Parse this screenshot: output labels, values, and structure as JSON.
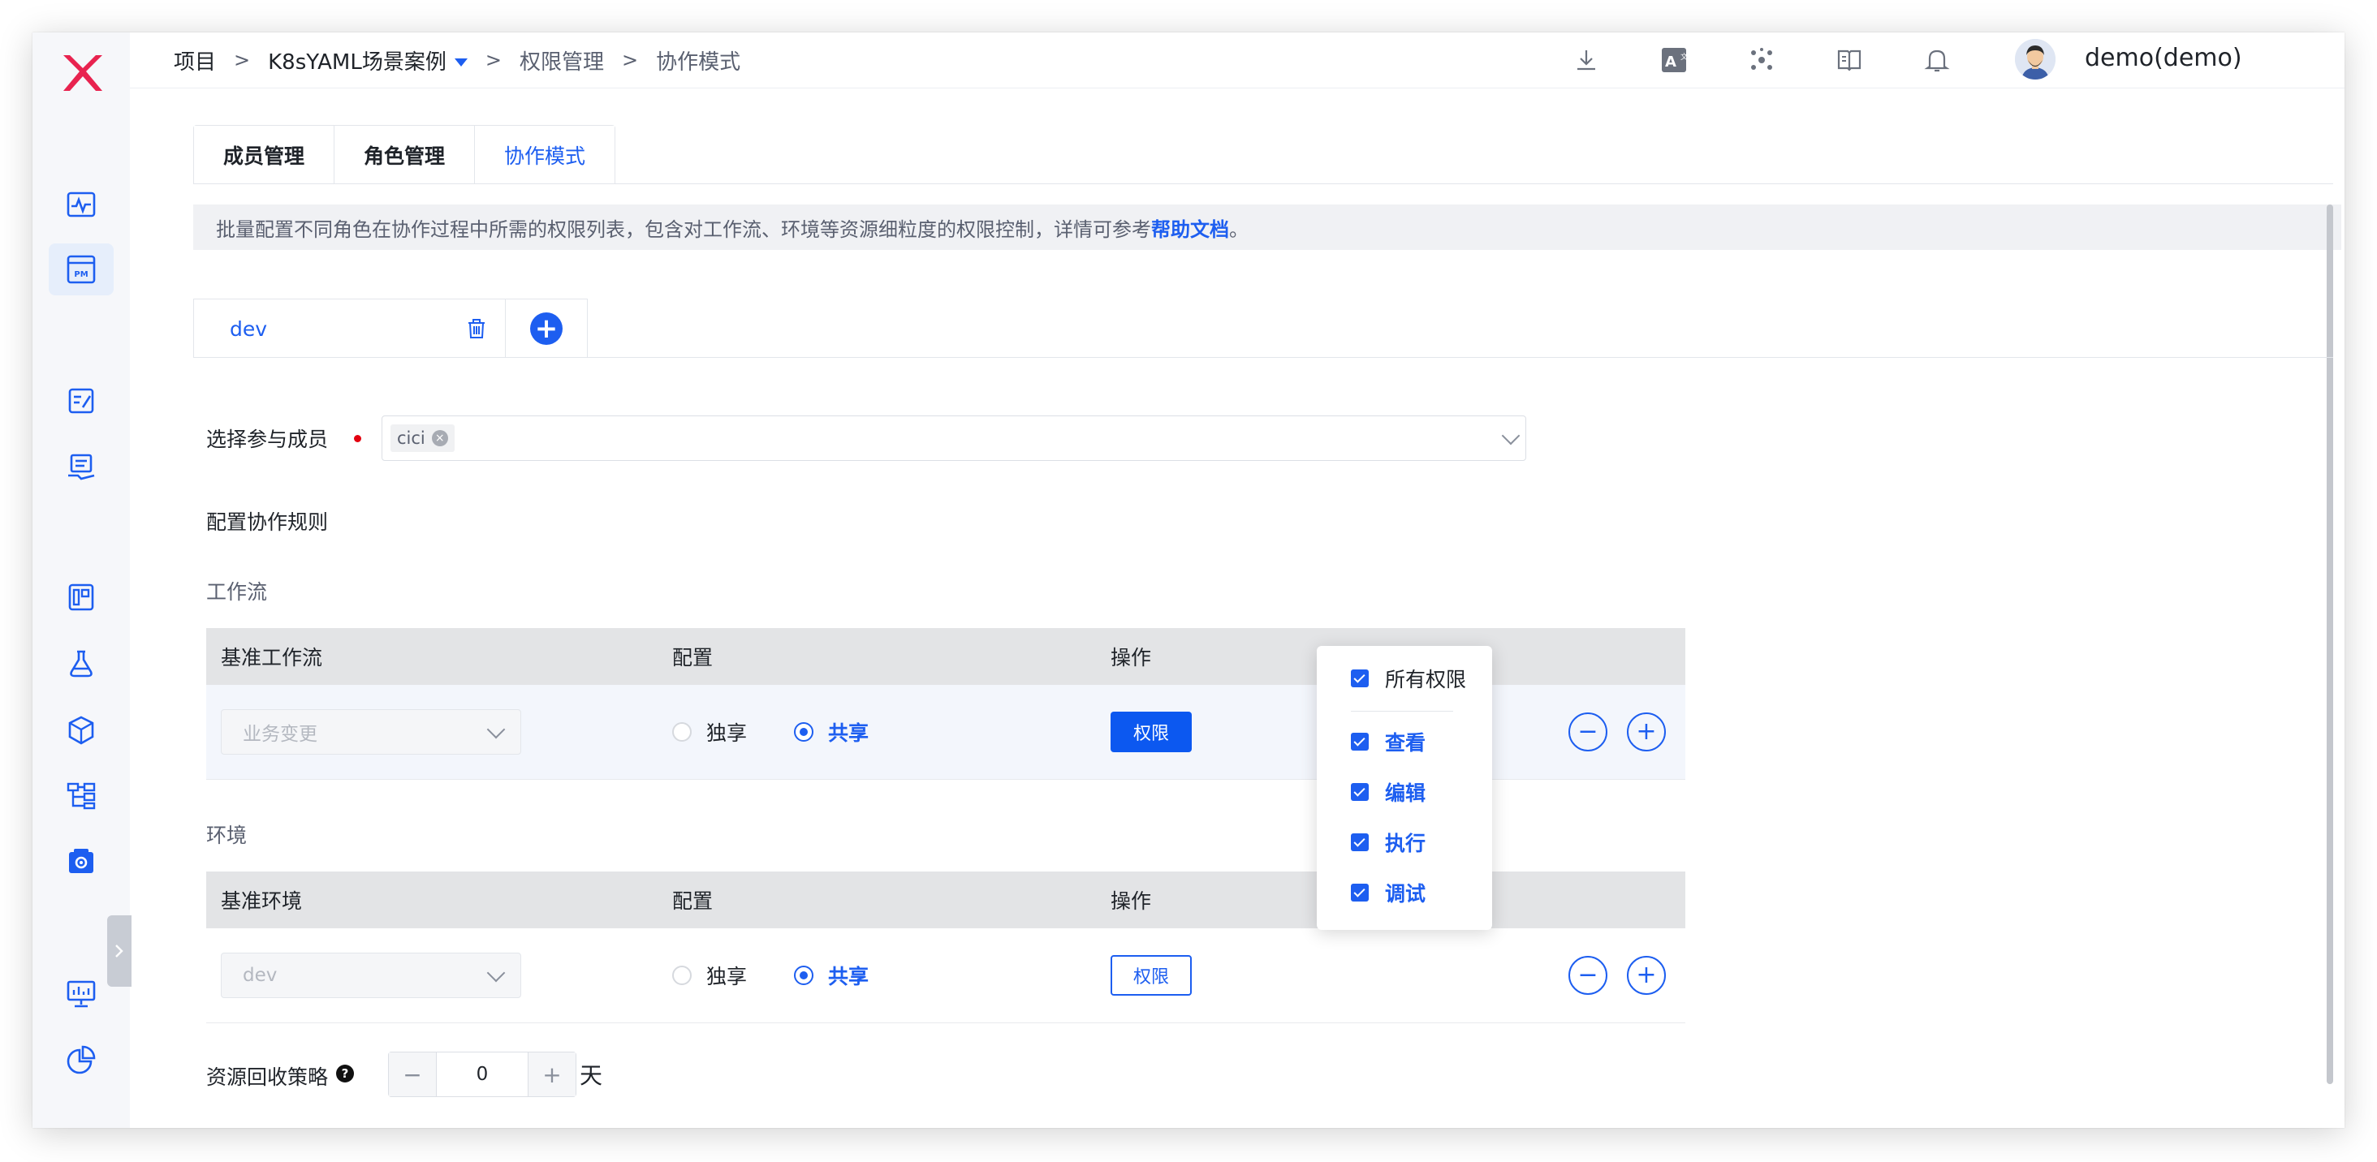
{
  "breadcrumb": {
    "root": "项目",
    "project": "K8sYAML场景案例",
    "section": "权限管理",
    "page": "协作模式",
    "sep": ">"
  },
  "user": {
    "name": "demo(demo)"
  },
  "tabs": [
    {
      "label": "成员管理"
    },
    {
      "label": "角色管理"
    },
    {
      "label": "协作模式"
    }
  ],
  "notice": {
    "text": "批量配置不同角色在协作过程中所需的权限列表，包含对工作流、环境等资源细粒度的权限控制，详情可参考 ",
    "link": "帮助文档",
    "suffix": "。"
  },
  "collab": {
    "name": "dev"
  },
  "members": {
    "label": "选择参与成员",
    "chips": [
      "cici"
    ]
  },
  "rules_title": "配置协作规则",
  "workflow": {
    "section_title": "工作流",
    "headers": [
      "基准工作流",
      "配置",
      "操作"
    ],
    "row": {
      "select": "业务变更",
      "exclusive": "独享",
      "shared": "共享",
      "perm_btn": "权限"
    }
  },
  "environment": {
    "section_title": "环境",
    "headers": [
      "基准环境",
      "配置",
      "操作"
    ],
    "row": {
      "select": "dev",
      "exclusive": "独享",
      "shared": "共享",
      "perm_btn": "权限"
    }
  },
  "popover": {
    "all": "所有权限",
    "items": [
      "查看",
      "编辑",
      "执行",
      "调试"
    ]
  },
  "recycle": {
    "label": "资源回收策略",
    "value": "0",
    "unit": "天",
    "minus": "−",
    "plus": "+"
  },
  "colors": {
    "accent": "#1d5ef0",
    "logo": "#e8234f",
    "required": "#e3000f"
  }
}
